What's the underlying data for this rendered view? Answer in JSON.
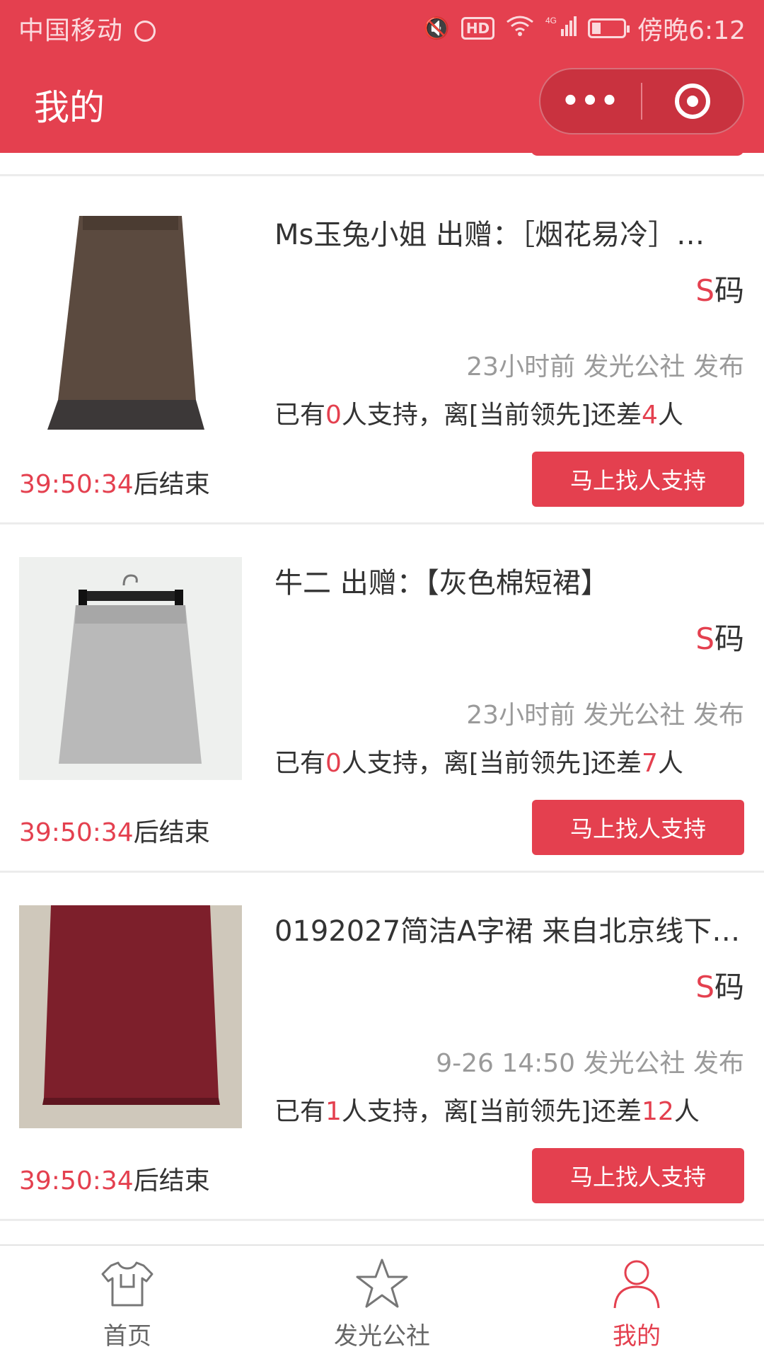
{
  "statusbar": {
    "carrier": "中国移动",
    "network": "4G",
    "hd": "HD",
    "time": "傍晚6:12"
  },
  "nav": {
    "title": "我的",
    "more_icon": "more-dots-icon",
    "close_icon": "target-icon"
  },
  "items": [
    {
      "title": "Ms玉兔小姐 出赠：［烟花易冷］…",
      "size_letter": "S",
      "size_suffix": "码",
      "time": "23小时前",
      "publisher": "发光公社 发布",
      "support_prefix": "已有",
      "support_count": "0",
      "support_mid": "人支持，离[当前领先]还差",
      "support_diff": "4",
      "support_suffix": "人",
      "countdown": "39:50:34",
      "countdown_suffix": "后结束",
      "cta": "马上找人支持",
      "image_color": "#5b4a3f"
    },
    {
      "title": "牛二 出赠：【灰色棉短裙】",
      "size_letter": "S",
      "size_suffix": "码",
      "time": "23小时前",
      "publisher": "发光公社 发布",
      "support_prefix": "已有",
      "support_count": "0",
      "support_mid": "人支持，离[当前领先]还差",
      "support_diff": "7",
      "support_suffix": "人",
      "countdown": "39:50:34",
      "countdown_suffix": "后结束",
      "cta": "马上找人支持",
      "image_color": "#a9a9a9"
    },
    {
      "title": "0192027简洁A字裙 来自北京线下…",
      "size_letter": "S",
      "size_suffix": "码",
      "time": "9-26 14:50",
      "publisher": "发光公社 发布",
      "support_prefix": "已有",
      "support_count": "1",
      "support_mid": "人支持，离[当前领先]还差",
      "support_diff": "12",
      "support_suffix": "人",
      "countdown": "39:50:34",
      "countdown_suffix": "后结束",
      "cta": "马上找人支持",
      "image_color": "#7d1f2b"
    }
  ],
  "tabbar": {
    "tabs": [
      {
        "label": "首页",
        "icon": "shirt-icon",
        "active": false
      },
      {
        "label": "发光公社",
        "icon": "star-icon",
        "active": false
      },
      {
        "label": "我的",
        "icon": "user-icon",
        "active": true
      }
    ]
  },
  "colors": {
    "accent": "#e4404f",
    "text": "#333333",
    "muted": "#9a9a9a"
  }
}
